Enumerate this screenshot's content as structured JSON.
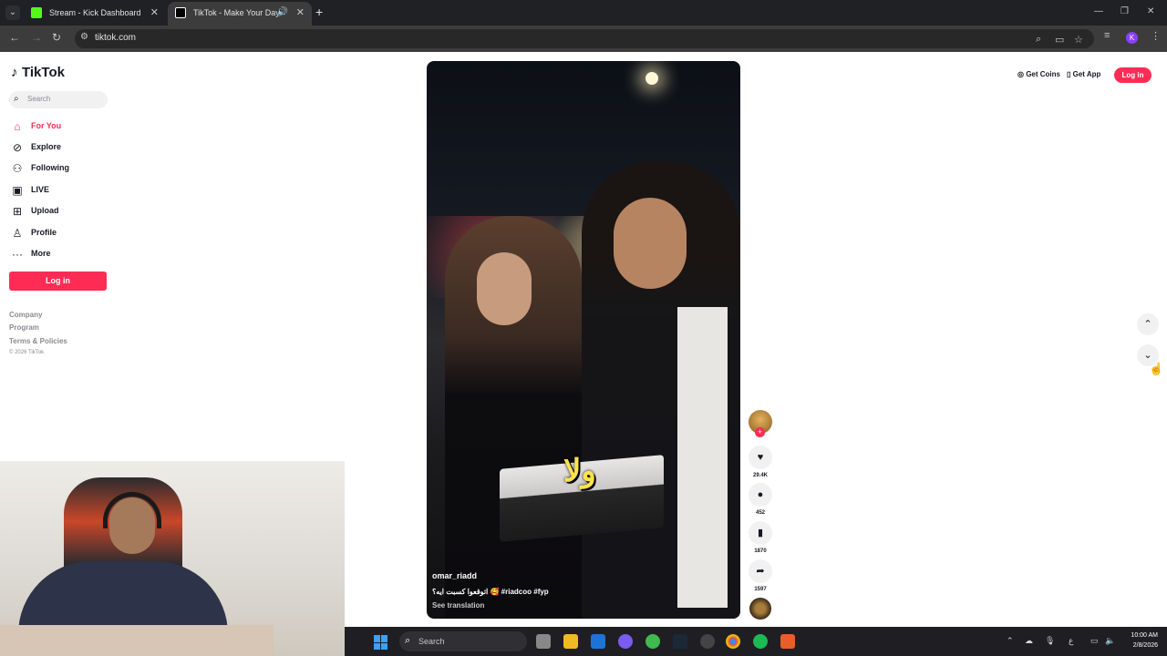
{
  "browser": {
    "tabs": [
      {
        "label": "Stream - Kick Dashboard"
      },
      {
        "label": "TikTok - Make Your Day"
      }
    ],
    "url": "tiktok.com"
  },
  "sidebar": {
    "logo": "TikTok",
    "search_placeholder": "Search",
    "items": [
      {
        "label": "For You",
        "icon": "home-icon"
      },
      {
        "label": "Explore",
        "icon": "compass-icon"
      },
      {
        "label": "Following",
        "icon": "user-plus-icon"
      },
      {
        "label": "LIVE",
        "icon": "live-icon"
      },
      {
        "label": "Upload",
        "icon": "upload-icon"
      },
      {
        "label": "Profile",
        "icon": "person-icon"
      },
      {
        "label": "More",
        "icon": "more-icon"
      }
    ],
    "login_label": "Log in",
    "footer": [
      "Company",
      "Program",
      "Terms & Policies"
    ],
    "copyright": "© 2026 TikTok"
  },
  "header": {
    "get_coins": "Get Coins",
    "get_app": "Get App",
    "login": "Log in"
  },
  "video": {
    "overlay_text": "ولا",
    "author": "omar_riadd",
    "caption": "اتوقعوا كسبت ايه؟ 🥰 #riadcoo #fyp",
    "see_translation": "See translation"
  },
  "actions": {
    "likes": "29.4K",
    "comments": "452",
    "saves": "1870",
    "shares": "1597"
  },
  "taskbar": {
    "search_placeholder": "Search",
    "time": "10:00 AM",
    "date": "2/8/2026",
    "lang": "ع"
  },
  "colors": {
    "accent": "#fe2c55",
    "browser_bg": "#202124",
    "taskbar_bg": "#1f1f23"
  }
}
